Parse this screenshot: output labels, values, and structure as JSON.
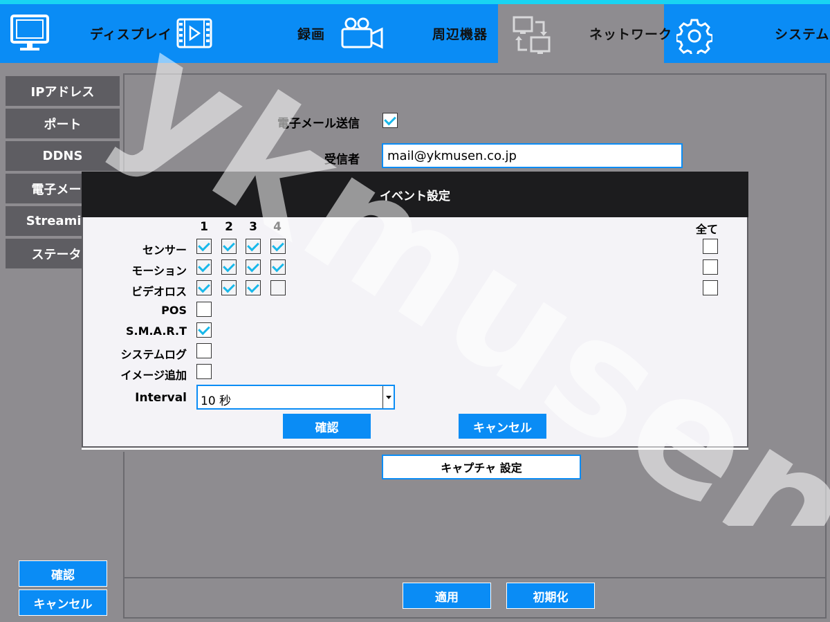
{
  "nav": {
    "display": "ディスプレイ",
    "record": "録画",
    "peripheral": "周辺機器",
    "network": "ネットワーク",
    "system": "システム"
  },
  "sidebar": {
    "items": [
      {
        "label": "IPアドレス"
      },
      {
        "label": "ポート"
      },
      {
        "label": "DDNS"
      },
      {
        "label": "電子メール"
      },
      {
        "label": "Streaming"
      },
      {
        "label": "ステータス"
      }
    ],
    "ok": "確認",
    "cancel": "キャンセル"
  },
  "email_form": {
    "send_label": "電子メール送信",
    "send_checked": true,
    "recipient_label": "受信者",
    "recipient_value": "mail@ykmusen.co.jp",
    "capture_button": "キャプチャ 設定"
  },
  "footer": {
    "apply": "適用",
    "reset": "初期化"
  },
  "dialog": {
    "title": "イベント設定",
    "columns": [
      "1",
      "2",
      "3",
      "4"
    ],
    "all_label": "全て",
    "rows": [
      {
        "label": "センサー",
        "checks": [
          true,
          true,
          true,
          true
        ],
        "all": false
      },
      {
        "label": "モーション",
        "checks": [
          true,
          true,
          true,
          true
        ],
        "all": false
      },
      {
        "label": "ビデオロス",
        "checks": [
          true,
          true,
          true,
          false
        ],
        "all": false
      }
    ],
    "options": [
      {
        "label": "POS",
        "checked": false
      },
      {
        "label": "S.M.A.R.T",
        "checked": true
      },
      {
        "label": "システムログ",
        "checked": false
      },
      {
        "label": "イメージ追加",
        "checked": false
      }
    ],
    "interval_label": "Interval",
    "interval_value": "10 秒",
    "ok": "確認",
    "cancel": "キャンセル"
  },
  "watermark": "ykmusen",
  "colors": {
    "accent": "#0a8cf5",
    "top_border": "#19d4f2",
    "background": "#8e8c90",
    "sidebar_button": "#5e5d62",
    "check": "#18b8ea"
  }
}
